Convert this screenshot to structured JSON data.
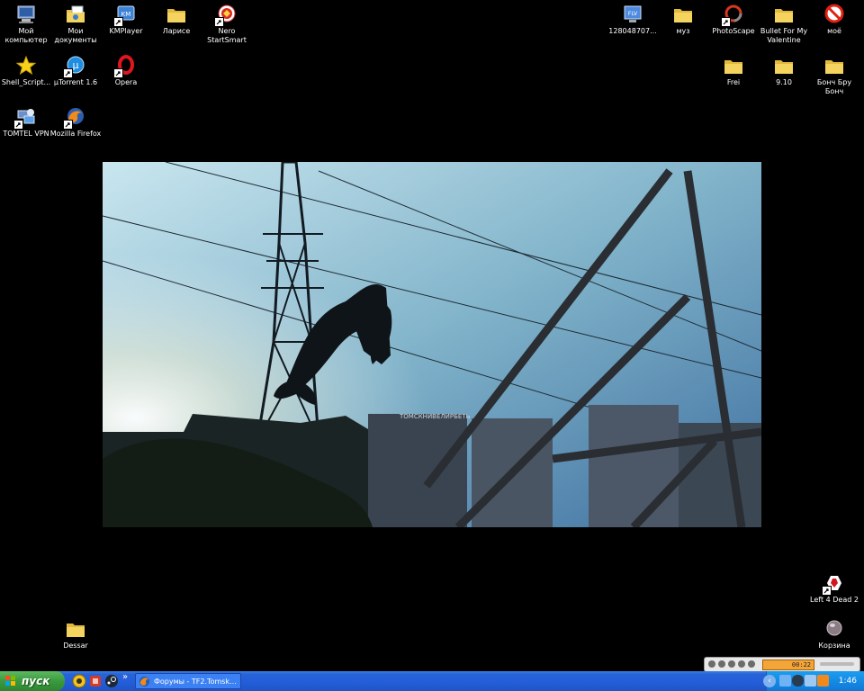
{
  "desktop": {
    "icons": {
      "my_computer": "Мой компьютер",
      "my_documents": "Мои документы",
      "kmplayer": "KMPlayer",
      "larise": "Ларисе",
      "nero": "Nero StartSmart",
      "shell_script": "Shell_Script...",
      "utorrent": "µTorrent 1.6",
      "opera": "Opera",
      "tomtel_vpn": "TOMTEL VPN",
      "firefox": "Mozilla Firefox",
      "file_1280": "128048707...",
      "muz": "муз",
      "photoscape": "PhotoScape",
      "bullet": "Bullet For My Valentine",
      "moe": "моё",
      "frei": "Frei",
      "nine_ten": "9.10",
      "bonch": "Бонч Бру Бонч",
      "left4dead": "Left 4 Dead 2",
      "dessar": "Dessar",
      "recycle": "Корзина"
    },
    "wallpaper_sign": "ТОМСКНИВЕЛИРБЕТЬ"
  },
  "taskbar": {
    "start_label": "пуск",
    "task_button_label": "Форумы - TF2.Tomsk...",
    "clock": "1:46",
    "player_time": "00:22"
  },
  "colors": {
    "taskbar_blue": "#245edb",
    "start_green": "#3a9a3e",
    "tray_blue": "#1b9df0",
    "folder_yellow": "#f4d35e"
  }
}
